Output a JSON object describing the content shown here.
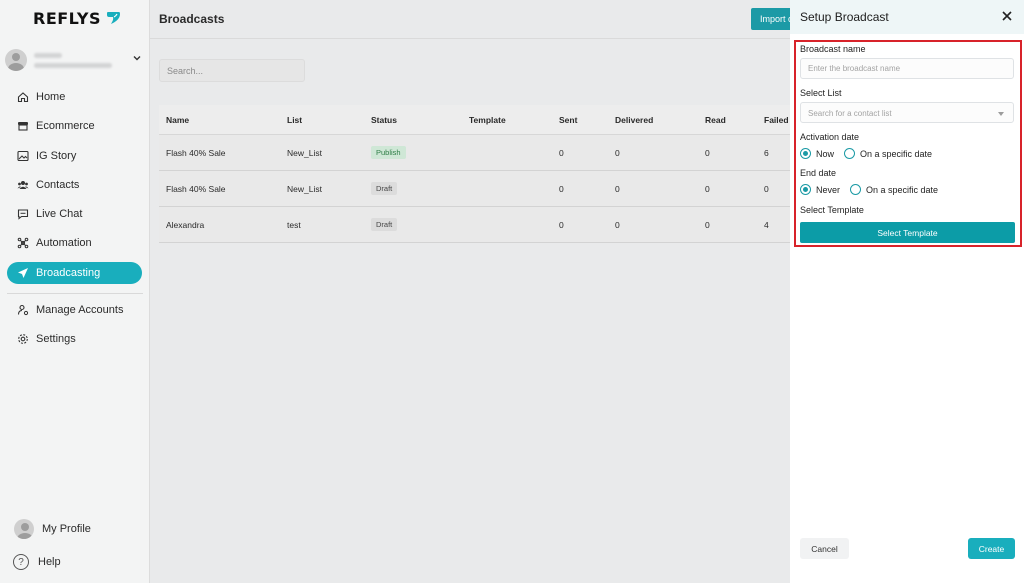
{
  "app": {
    "logo_text": "REFLYS",
    "accent": "#19aebd",
    "highlight": "#d8232a"
  },
  "sidebar": {
    "items": [
      {
        "label": "Home",
        "icon": "home-icon"
      },
      {
        "label": "Ecommerce",
        "icon": "store-icon"
      },
      {
        "label": "IG Story",
        "icon": "image-icon"
      },
      {
        "label": "Contacts",
        "icon": "users-icon"
      },
      {
        "label": "Live Chat",
        "icon": "chat-icon"
      },
      {
        "label": "Automation",
        "icon": "automation-icon"
      },
      {
        "label": "Broadcasting",
        "icon": "send-icon",
        "active": true
      },
      {
        "label": "Manage Accounts",
        "icon": "user-cog-icon"
      },
      {
        "label": "Settings",
        "icon": "gear-icon"
      }
    ],
    "profile_label": "My Profile",
    "help_label": "Help",
    "help_glyph": "?"
  },
  "main": {
    "title": "Broadcasts",
    "import_label": "Import c",
    "search_placeholder": "Search...",
    "columns": [
      "Name",
      "List",
      "Status",
      "Template",
      "Sent",
      "Delivered",
      "Read",
      "Failed"
    ],
    "rows": [
      {
        "name": "Flash 40% Sale",
        "list": "New_List",
        "status": "Publish",
        "template": "",
        "sent": "0",
        "delivered": "0",
        "read": "0",
        "failed": "6"
      },
      {
        "name": "Flash 40% Sale",
        "list": "New_List",
        "status": "Draft",
        "template": "",
        "sent": "0",
        "delivered": "0",
        "read": "0",
        "failed": "0"
      },
      {
        "name": "Alexandra",
        "list": "test",
        "status": "Draft",
        "template": "",
        "sent": "0",
        "delivered": "0",
        "read": "0",
        "failed": "4"
      }
    ]
  },
  "panel": {
    "title": "Setup Broadcast",
    "broadcast_name_label": "Broadcast name",
    "broadcast_name_placeholder": "Enter the broadcast name",
    "select_list_label": "Select List",
    "select_list_placeholder": "Search for a contact list",
    "activation_label": "Activation date",
    "activation_options": [
      "Now",
      "On a specific date"
    ],
    "end_label": "End date",
    "end_options": [
      "Never",
      "On a specific date"
    ],
    "template_label": "Select Template",
    "template_button": "Select Template",
    "cancel_label": "Cancel",
    "create_label": "Create"
  }
}
